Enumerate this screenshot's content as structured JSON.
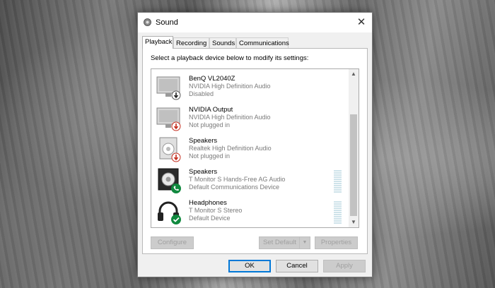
{
  "window": {
    "title": "Sound",
    "close_glyph": "✕",
    "app_icon": "speaker-icon"
  },
  "tabs": [
    {
      "label": "Playback",
      "active": true
    },
    {
      "label": "Recording",
      "active": false
    },
    {
      "label": "Sounds",
      "active": false
    },
    {
      "label": "Communications",
      "active": false
    }
  ],
  "instruction": "Select a playback device below to modify its settings:",
  "devices": [
    {
      "name": "BenQ VL2040Z",
      "driver": "NVIDIA High Definition Audio",
      "status": "Disabled",
      "icon": "monitor-icon",
      "badge": "disabled-arrow-icon"
    },
    {
      "name": "NVIDIA Output",
      "driver": "NVIDIA High Definition Audio",
      "status": "Not plugged in",
      "icon": "monitor-icon",
      "badge": "unplugged-arrow-icon"
    },
    {
      "name": "Speakers",
      "driver": "Realtek High Definition Audio",
      "status": "Not plugged in",
      "icon": "speaker-icon",
      "badge": "unplugged-arrow-icon"
    },
    {
      "name": "Speakers",
      "driver": "T Monitor S Hands-Free AG Audio",
      "status": "Default Communications Device",
      "icon": "speaker-icon",
      "badge": "phone-badge-icon"
    },
    {
      "name": "Headphones",
      "driver": "T Monitor S Stereo",
      "status": "Default Device",
      "icon": "headphones-icon",
      "badge": "check-badge-icon"
    }
  ],
  "scroll": {
    "up_glyph": "▲",
    "down_glyph": "▼"
  },
  "buttons": {
    "configure": "Configure",
    "set_default": "Set Default",
    "set_default_arrow": "▼",
    "properties": "Properties",
    "ok": "OK",
    "cancel": "Cancel",
    "apply": "Apply"
  },
  "colors": {
    "accent": "#0078d7",
    "red_badge": "#c42b1c",
    "green_badge": "#10893e"
  }
}
